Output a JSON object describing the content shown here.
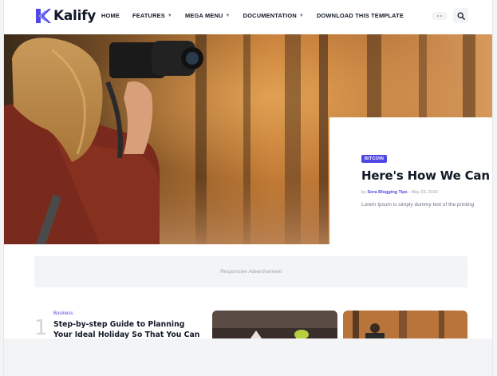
{
  "brand": {
    "name": "Kalify"
  },
  "nav": {
    "items": [
      {
        "label": "HOME",
        "has_dropdown": false
      },
      {
        "label": "FEATURES",
        "has_dropdown": true
      },
      {
        "label": "MEGA MENU",
        "has_dropdown": true
      },
      {
        "label": "DOCUMENTATION",
        "has_dropdown": true
      },
      {
        "label": "DOWNLOAD THIS TEMPLATE",
        "has_dropdown": false
      }
    ],
    "caret_icon": "chevron-down-icon",
    "search_icon": "search-icon"
  },
  "hero": {
    "badge": "BITCOIN",
    "title": "Here's How We Can W",
    "meta_prefix": "by",
    "author": "Sora Blogging Tips",
    "date": "May 23, 2016",
    "excerpt": "Lorem Ipsum is simply dummy text of the printing"
  },
  "ad": {
    "label": "Responsive Advertisement"
  },
  "posts": [
    {
      "number": "1",
      "category": "Business",
      "title": "Step-by-step Guide to Planning Your Ideal Holiday So That You Can Enjoy"
    }
  ],
  "colors": {
    "accent": "#4f46e5",
    "text_dark": "#111827",
    "muted": "#9ca3af",
    "ad_bg": "#f3f4f5"
  }
}
